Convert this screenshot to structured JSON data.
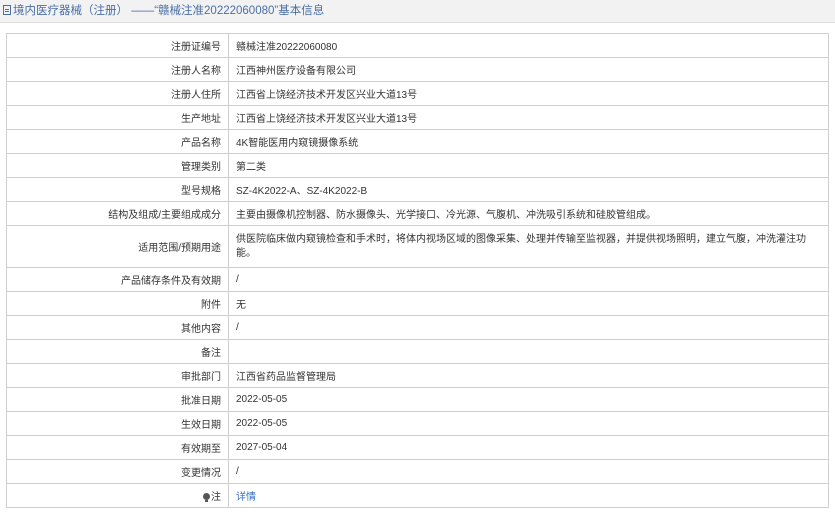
{
  "header": {
    "icon": "document-icon",
    "title": "境内医疗器械（注册） ——“赣械注准20222060080”基本信息"
  },
  "rows": [
    {
      "label": "注册证编号",
      "value": "赣械注准20222060080"
    },
    {
      "label": "注册人名称",
      "value": "江西神州医疗设备有限公司"
    },
    {
      "label": "注册人住所",
      "value": "江西省上饶经济技术开发区兴业大道13号"
    },
    {
      "label": "生产地址",
      "value": "江西省上饶经济技术开发区兴业大道13号"
    },
    {
      "label": "产品名称",
      "value": "4K智能医用内窥镜摄像系统"
    },
    {
      "label": "管理类别",
      "value": "第二类"
    },
    {
      "label": "型号规格",
      "value": "SZ-4K2022-A、SZ-4K2022-B"
    },
    {
      "label": "结构及组成/主要组成成分",
      "value": "主要由摄像机控制器、防水摄像头、光学接口、冷光源、气腹机、冲洗吸引系统和硅胶管组成。"
    },
    {
      "label": "适用范围/预期用途",
      "value": "供医院临床做内窥镜检查和手术时，将体内视场区域的图像采集、处理并传输至监视器，并提供视场照明，建立气腹，冲洗灌注功能。"
    },
    {
      "label": "产品储存条件及有效期",
      "value": "/"
    },
    {
      "label": "附件",
      "value": "无"
    },
    {
      "label": "其他内容",
      "value": "/"
    },
    {
      "label": "备注",
      "value": ""
    },
    {
      "label": "审批部门",
      "value": "江西省药品监督管理局"
    },
    {
      "label": "批准日期",
      "value": "2022-05-05"
    },
    {
      "label": "生效日期",
      "value": "2022-05-05"
    },
    {
      "label": "有效期至",
      "value": "2027-05-04"
    },
    {
      "label": "变更情况",
      "value": "/"
    }
  ],
  "note": {
    "icon": "lightbulb-icon",
    "label": "注",
    "link_text": "详情",
    "link_color": "#2f6fc1"
  }
}
